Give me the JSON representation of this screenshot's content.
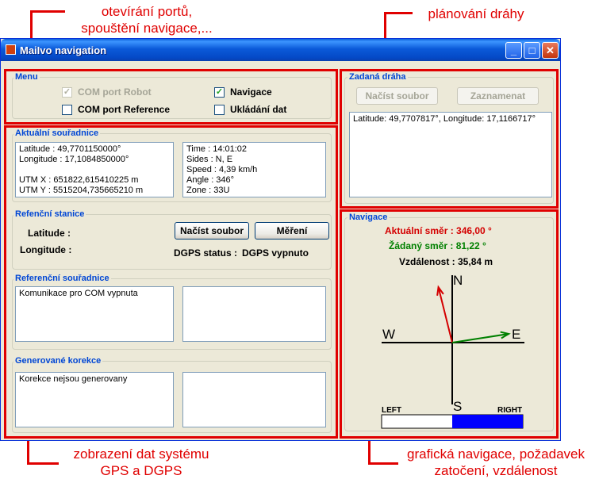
{
  "annotations": {
    "ports_line1": "otevírání portů,",
    "ports_line2": "spouštění navigace,...",
    "path_planning": "plánování dráhy",
    "gps_line1": "zobrazení dat systému",
    "gps_line2": "GPS a DGPS",
    "nav_line1": "grafická navigace, požadavek",
    "nav_line2": "zatočení, vzdálenost"
  },
  "window": {
    "title": "MaiIvo navigation",
    "minimize": "_",
    "maximize": "□",
    "close": "✕"
  },
  "menu": {
    "title": "Menu",
    "com_robot": {
      "label": "COM port Robot",
      "checked": true,
      "disabled": true
    },
    "navigace": {
      "label": "Navigace",
      "checked": true,
      "disabled": false
    },
    "com_reference": {
      "label": "COM port Reference",
      "checked": false,
      "disabled": false
    },
    "ukladani": {
      "label": "Ukládání dat",
      "checked": false,
      "disabled": false
    }
  },
  "current_coords": {
    "title": "Aktuální souřadnice",
    "left_text": "Latitude : 49,7701150000°\nLongitude : 17,1084850000°\n\nUTM X : 651822,615410225 m\nUTM Y : 5515204,735665210 m",
    "right_text": "Time : 14:01:02\nSides : N, E\nSpeed : 4,39 km/h\nAngle : 346°\nZone : 33U"
  },
  "reference_station": {
    "title": "Refenční stanice",
    "latitude_label": "Latitude :",
    "longitude_label": "Longitude :",
    "load_button": "Načíst soubor",
    "measure_button": "Měření",
    "dgps_status_label": "DGPS status :",
    "dgps_status_value": "DGPS vypnuto"
  },
  "reference_coords": {
    "title": "Referenční souřadnice",
    "left_text": "Komunikace pro COM vypnuta",
    "right_text": ""
  },
  "generated_corrections": {
    "title": "Generované korekce",
    "left_text": "Korekce nejsou generovany",
    "right_text": ""
  },
  "path": {
    "title": "Zadaná dráha",
    "load_button": "Načíst soubor",
    "record_button": "Zaznamenat",
    "text": "Latitude: 49,7707817°, Longitude: 17,1166717°"
  },
  "navigation": {
    "title": "Navigace",
    "current_dir_label": "Aktuální směr : 346,00 °",
    "required_dir_label": "Žádaný směr : 81,22 °",
    "distance_label": "Vzdálenost : 35,84 m",
    "current_angle_deg": 346,
    "required_angle_deg": 81.22,
    "compass": {
      "n": "N",
      "s": "S",
      "w": "W",
      "e": "E"
    },
    "left_label": "LEFT",
    "right_label": "RIGHT",
    "turn_right_fraction": 0.5,
    "colors": {
      "current": "#d40000",
      "required": "#008000",
      "turn_fill": "#0000ff"
    }
  }
}
